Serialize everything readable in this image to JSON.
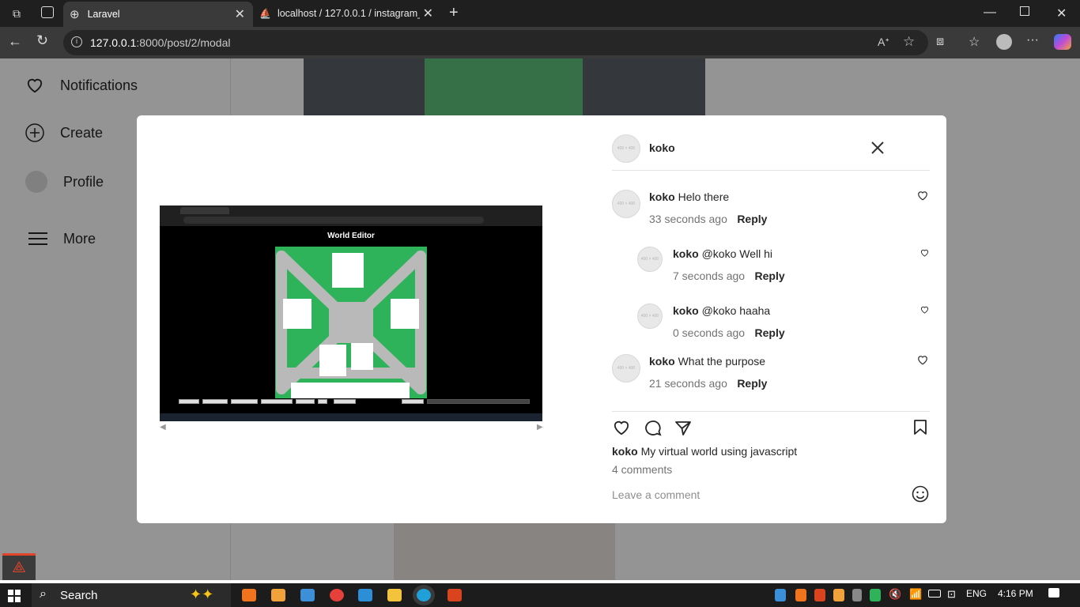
{
  "browser": {
    "tabs": [
      {
        "label": "Laravel"
      },
      {
        "label": "localhost / 127.0.0.1 / instagram_c"
      }
    ],
    "url": {
      "host": "127.0.0.1",
      "path": ":8000/post/2/modal"
    }
  },
  "sidebar": {
    "items": [
      {
        "label": "Notifications",
        "icon": "heart-icon"
      },
      {
        "label": "Create",
        "icon": "plus-icon"
      },
      {
        "label": "Profile",
        "icon": "avatar-icon"
      },
      {
        "label": "More",
        "icon": "menu-icon"
      }
    ]
  },
  "post": {
    "image": {
      "title": "World Editor"
    },
    "header_user": "koko",
    "avatar_placeholder": "400 × 400",
    "comments": [
      {
        "user": "koko",
        "text": "Helo there",
        "time": "33 seconds ago",
        "reply": "Reply"
      },
      {
        "user": "koko",
        "text": "@koko Well hi",
        "time": "7 seconds ago",
        "reply": "Reply"
      },
      {
        "user": "koko",
        "text": "@koko haaha",
        "time": "0 seconds ago",
        "reply": "Reply"
      },
      {
        "user": "koko",
        "text": "What the purpose",
        "time": "21 seconds ago",
        "reply": "Reply"
      }
    ],
    "caption_user": "koko",
    "caption_text": "My virtual world using javascript",
    "comments_count": "4 comments",
    "comment_placeholder": "Leave a comment"
  },
  "taskbar": {
    "search": "Search",
    "lang": "ENG",
    "time": "4:16 PM"
  }
}
